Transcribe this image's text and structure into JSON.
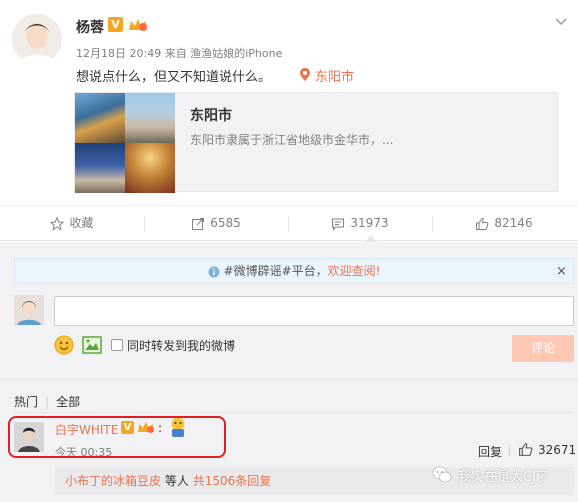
{
  "post": {
    "author": "杨蓉",
    "v_badge": "V",
    "time": "12月18日 20:49",
    "source_prefix": "来自",
    "source": "渔渔姑娘的iPhone",
    "text": "想说点什么，但又不知道说什么。",
    "location": "东阳市"
  },
  "location_card": {
    "title": "东阳市",
    "description": "东阳市隶属于浙江省地级市金华市，..."
  },
  "actions": {
    "favorite_label": "收藏",
    "repost_count": "6585",
    "comment_count": "31973",
    "like_count": "82146"
  },
  "comment_box": {
    "notice_tag": "#微博辟谣#平台，",
    "notice_link": "欢迎查阅!",
    "close_symbol": "×",
    "repost_label": "同时转发到我的微博",
    "submit_label": "评论"
  },
  "tabs": {
    "hot": "热门",
    "all": "全部"
  },
  "comment": {
    "user": "白宇WHITE",
    "v_badge": "V",
    "colon": ":",
    "time": "今天 00:35",
    "reply_label": "回复",
    "like_count": "32671"
  },
  "sub_replies": {
    "user": "小布丁的冰箱豆皮",
    "middle": "等人",
    "count_text": "共1506条回复"
  },
  "watermark": {
    "text": "我实在是太CJ了"
  },
  "colors": {
    "accent_orange": "#eb7350",
    "vip_gold": "#f5a623",
    "highlight_red": "#e02020"
  }
}
